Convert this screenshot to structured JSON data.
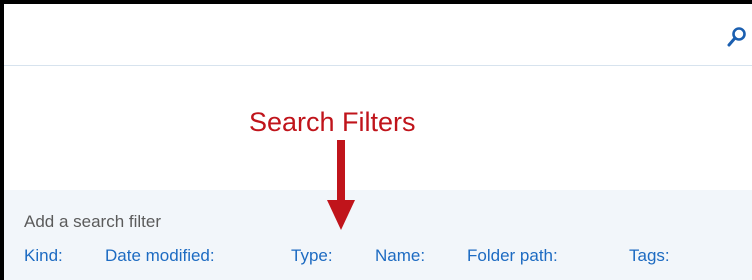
{
  "annotation": {
    "label": "Search Filters"
  },
  "filter_panel": {
    "heading": "Add a search filter",
    "filters": [
      "Kind:",
      "Date modified:",
      "Type:",
      "Name:",
      "Folder path:",
      "Tags:"
    ]
  },
  "icons": {
    "search": "search-icon",
    "arrow": "arrow-down-icon"
  },
  "colors": {
    "annotation": "#c0141b",
    "filter_link": "#1d6bc2",
    "panel_background": "#f2f6fa",
    "search_icon": "#1b5fb0"
  }
}
